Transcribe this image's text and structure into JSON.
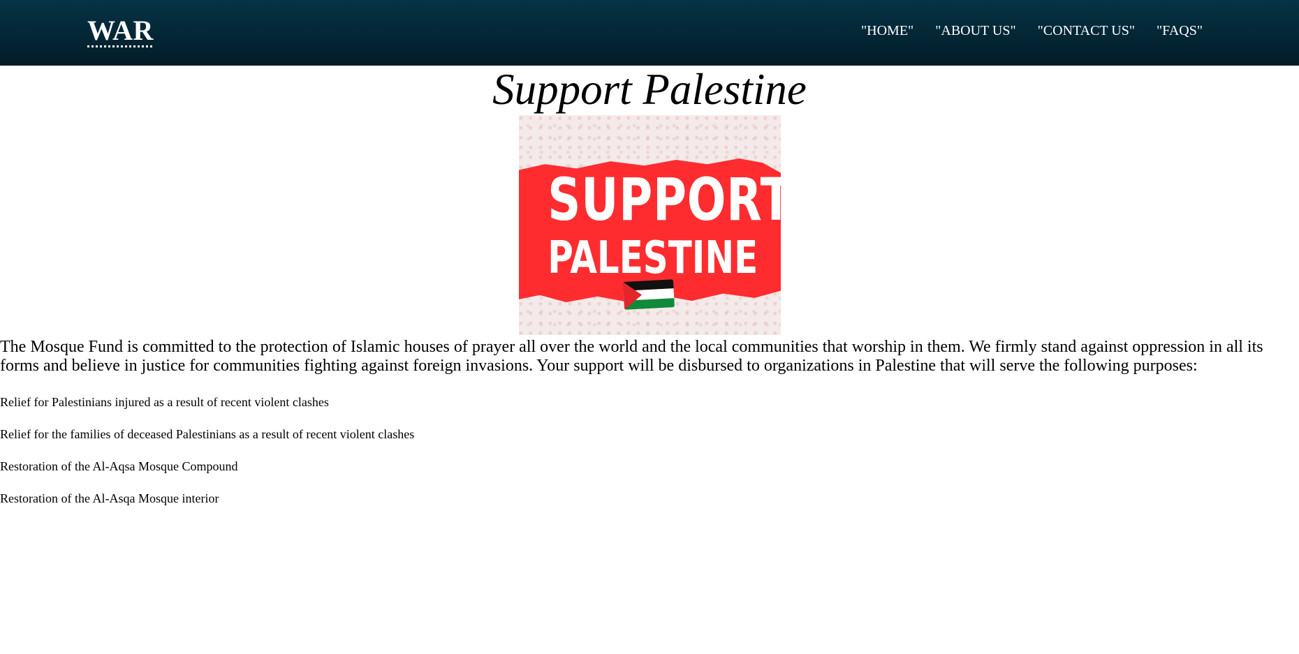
{
  "header": {
    "logo": "WAR",
    "nav": [
      "\"HOME\"",
      "\"ABOUT US\"",
      "\"CONTACT US\"",
      "\"FAQS\""
    ]
  },
  "main": {
    "title": "Support Palestine",
    "banner": {
      "line1": "SUPPORT",
      "line2": "PALESTINE",
      "flag": "palestine-flag-icon"
    },
    "intro": "The Mosque Fund is committed to the protection of Islamic houses of prayer all over the world and the local communities that worship in them. We firmly stand against oppression in all its forms and believe in justice for communities fighting against foreign invasions. Your support will be disbursed to organizations in Palestine that will serve the following purposes:",
    "purposes": [
      "Relief for Palestinians injured as a result of recent violent clashes",
      "Relief for the families of deceased Palestinians as a result of recent violent clashes",
      "Restoration of the Al-Aqsa Mosque Compound",
      "Restoration of the Al-Asqa Mosque interior"
    ]
  },
  "colors": {
    "navbar": "#042a3a",
    "banner_red": "#ff2c2f"
  }
}
